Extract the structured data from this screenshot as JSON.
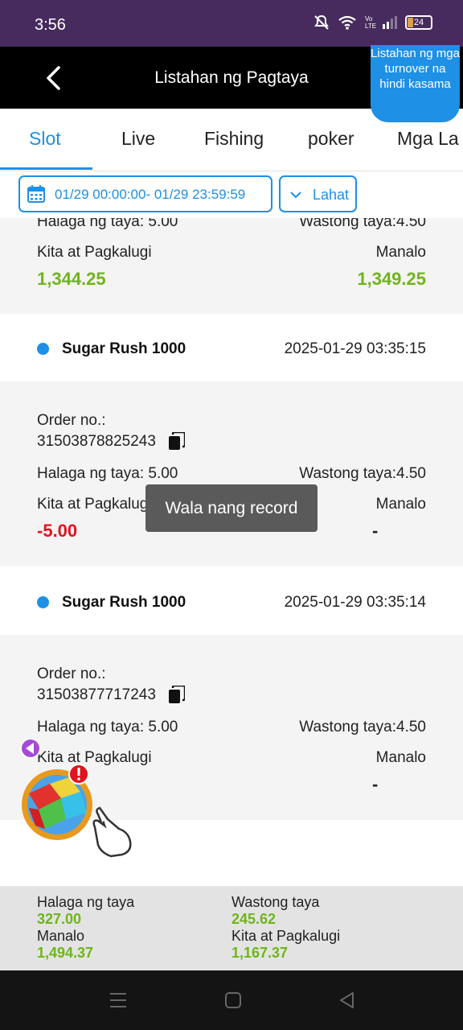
{
  "status_bar": {
    "time": "3:56",
    "battery": "24"
  },
  "header": {
    "title": "Listahan ng Pagtaya",
    "turnover_button": "Listahan ng mga turnover na hindi kasama"
  },
  "tabs": [
    {
      "label": "Slot",
      "active": true
    },
    {
      "label": "Live"
    },
    {
      "label": "Fishing"
    },
    {
      "label": "poker"
    },
    {
      "label": "Mga La"
    }
  ],
  "filters": {
    "date_range": "01/29 00:00:00- 01/29 23:59:59",
    "status": "Lahat"
  },
  "records": [
    {
      "bet_amount": "Halaga ng taya: 5.00",
      "valid_bet": "Wastong taya:4.50",
      "profit_label": "Kita at Pagkalugi",
      "profit": "1,344.25",
      "result_label": "Manalo",
      "result": "1,349.25"
    },
    {
      "game": "Sugar Rush 1000",
      "time": "2025-01-29 03:35:15",
      "order_label": "Order no.:",
      "order_no": "31503878825243",
      "bet_amount": "Halaga ng taya: 5.00",
      "valid_bet": "Wastong taya:4.50",
      "profit_label": "Kita at Pagkalugi",
      "profit": "-5.00",
      "result_label": "Manalo",
      "result": "-"
    },
    {
      "game": "Sugar Rush 1000",
      "time": "2025-01-29 03:35:14",
      "order_label": "Order no.:",
      "order_no": "31503877717243",
      "bet_amount": "Halaga ng taya: 5.00",
      "valid_bet": "Wastong taya:4.50",
      "profit_label": "Kita at Pagkalugi",
      "profit": "",
      "result_label": "Manalo",
      "result": "-"
    }
  ],
  "toast": "Wala nang record",
  "summary": {
    "bet_label": "Halaga ng taya",
    "bet_value": "327.00",
    "valid_label": "Wastong taya",
    "valid_value": "245.62",
    "win_label": "Manalo",
    "win_value": "1,494.37",
    "profit_label": "Kita at Pagkalugi",
    "profit_value": "1,167.37"
  },
  "colors": {
    "accent": "#1e90e5",
    "positive": "#6fb51a",
    "negative": "#e0141e",
    "status_bar": "#472b5e"
  },
  "icons": [
    "back-arrow-icon",
    "calendar-icon",
    "chevron-down-icon",
    "copy-icon",
    "mute-icon",
    "wifi-icon",
    "signal-icon",
    "battery-icon"
  ]
}
